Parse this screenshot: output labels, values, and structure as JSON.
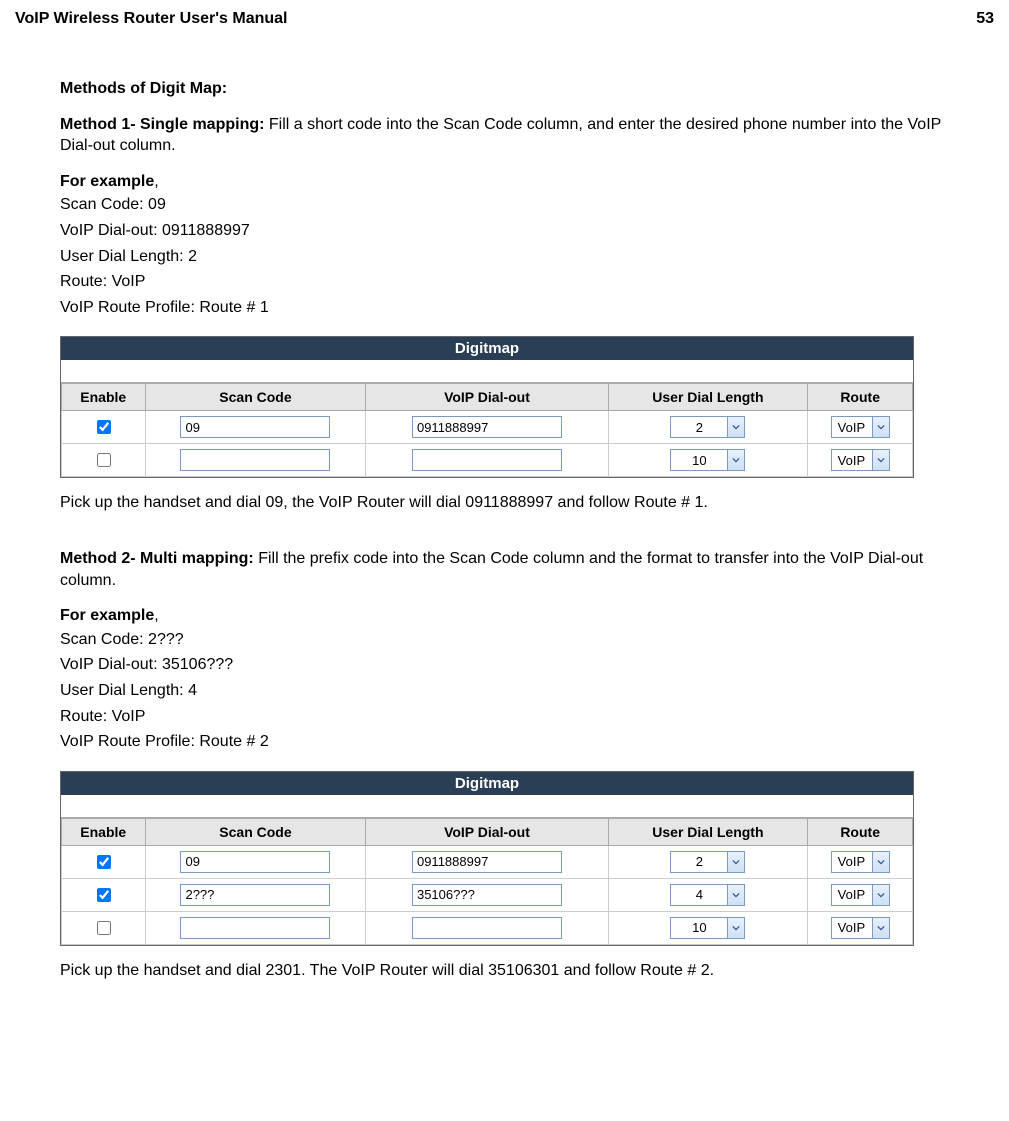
{
  "header": {
    "title": "VoIP Wireless Router User's Manual",
    "page": "53"
  },
  "section_title": "Methods of Digit Map:",
  "method1": {
    "title": "Method 1- Single mapping:",
    "desc": " Fill a short code into the Scan Code column, and enter the desired phone number into the VoIP Dial-out column.",
    "example_label": "For example",
    "lines": [
      "Scan Code: 09",
      "VoIP Dial-out: 0911888997",
      "User Dial Length: 2",
      "Route: VoIP",
      "VoIP Route Profile: Route # 1"
    ],
    "footer": "Pick up the handset and dial 09, the VoIP Router will dial 0911888997 and follow Route # 1."
  },
  "method2": {
    "title": "Method 2- Multi mapping:",
    "desc": " Fill the prefix code into the Scan Code column and the format to transfer into the VoIP Dial-out column.",
    "example_label": "For example",
    "lines": [
      "Scan Code: 2???",
      "VoIP Dial-out: 35106???",
      "User Dial Length: 4",
      "Route: VoIP",
      "VoIP Route Profile: Route # 2"
    ],
    "footer": "Pick up the handset and dial 2301. The VoIP Router will dial 35106301 and follow Route # 2."
  },
  "digitmap_title": "Digitmap",
  "columns": {
    "enable": "Enable",
    "scan": "Scan Code",
    "dial": "VoIP Dial-out",
    "len": "User Dial Length",
    "route": "Route"
  },
  "table1": {
    "rows": [
      {
        "enabled": true,
        "scan": "09",
        "dial": "0911888997",
        "len": "2",
        "route": "VoIP"
      },
      {
        "enabled": false,
        "scan": "",
        "dial": "",
        "len": "10",
        "route": "VoIP"
      }
    ]
  },
  "table2": {
    "rows": [
      {
        "enabled": true,
        "scan": "09",
        "dial": "0911888997",
        "len": "2",
        "route": "VoIP"
      },
      {
        "enabled": true,
        "scan": "2???",
        "dial": "35106???",
        "len": "4",
        "route": "VoIP"
      },
      {
        "enabled": false,
        "scan": "",
        "dial": "",
        "len": "10",
        "route": "VoIP"
      }
    ]
  }
}
